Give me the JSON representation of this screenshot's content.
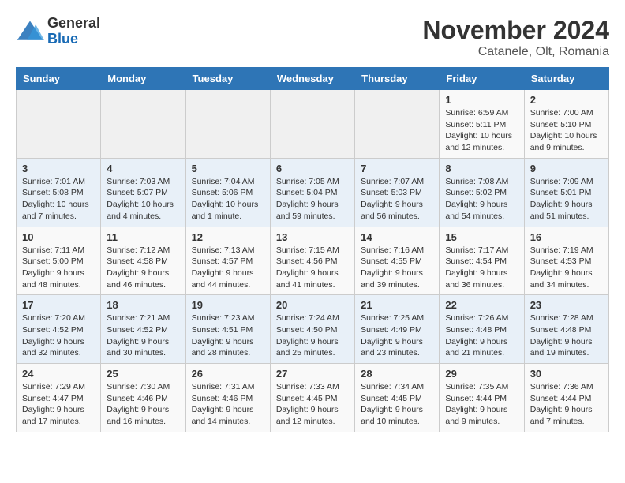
{
  "logo": {
    "general": "General",
    "blue": "Blue"
  },
  "header": {
    "month": "November 2024",
    "location": "Catanele, Olt, Romania"
  },
  "weekdays": [
    "Sunday",
    "Monday",
    "Tuesday",
    "Wednesday",
    "Thursday",
    "Friday",
    "Saturday"
  ],
  "weeks": [
    [
      {
        "day": "",
        "info": ""
      },
      {
        "day": "",
        "info": ""
      },
      {
        "day": "",
        "info": ""
      },
      {
        "day": "",
        "info": ""
      },
      {
        "day": "",
        "info": ""
      },
      {
        "day": "1",
        "info": "Sunrise: 6:59 AM\nSunset: 5:11 PM\nDaylight: 10 hours and 12 minutes."
      },
      {
        "day": "2",
        "info": "Sunrise: 7:00 AM\nSunset: 5:10 PM\nDaylight: 10 hours and 9 minutes."
      }
    ],
    [
      {
        "day": "3",
        "info": "Sunrise: 7:01 AM\nSunset: 5:08 PM\nDaylight: 10 hours and 7 minutes."
      },
      {
        "day": "4",
        "info": "Sunrise: 7:03 AM\nSunset: 5:07 PM\nDaylight: 10 hours and 4 minutes."
      },
      {
        "day": "5",
        "info": "Sunrise: 7:04 AM\nSunset: 5:06 PM\nDaylight: 10 hours and 1 minute."
      },
      {
        "day": "6",
        "info": "Sunrise: 7:05 AM\nSunset: 5:04 PM\nDaylight: 9 hours and 59 minutes."
      },
      {
        "day": "7",
        "info": "Sunrise: 7:07 AM\nSunset: 5:03 PM\nDaylight: 9 hours and 56 minutes."
      },
      {
        "day": "8",
        "info": "Sunrise: 7:08 AM\nSunset: 5:02 PM\nDaylight: 9 hours and 54 minutes."
      },
      {
        "day": "9",
        "info": "Sunrise: 7:09 AM\nSunset: 5:01 PM\nDaylight: 9 hours and 51 minutes."
      }
    ],
    [
      {
        "day": "10",
        "info": "Sunrise: 7:11 AM\nSunset: 5:00 PM\nDaylight: 9 hours and 48 minutes."
      },
      {
        "day": "11",
        "info": "Sunrise: 7:12 AM\nSunset: 4:58 PM\nDaylight: 9 hours and 46 minutes."
      },
      {
        "day": "12",
        "info": "Sunrise: 7:13 AM\nSunset: 4:57 PM\nDaylight: 9 hours and 44 minutes."
      },
      {
        "day": "13",
        "info": "Sunrise: 7:15 AM\nSunset: 4:56 PM\nDaylight: 9 hours and 41 minutes."
      },
      {
        "day": "14",
        "info": "Sunrise: 7:16 AM\nSunset: 4:55 PM\nDaylight: 9 hours and 39 minutes."
      },
      {
        "day": "15",
        "info": "Sunrise: 7:17 AM\nSunset: 4:54 PM\nDaylight: 9 hours and 36 minutes."
      },
      {
        "day": "16",
        "info": "Sunrise: 7:19 AM\nSunset: 4:53 PM\nDaylight: 9 hours and 34 minutes."
      }
    ],
    [
      {
        "day": "17",
        "info": "Sunrise: 7:20 AM\nSunset: 4:52 PM\nDaylight: 9 hours and 32 minutes."
      },
      {
        "day": "18",
        "info": "Sunrise: 7:21 AM\nSunset: 4:52 PM\nDaylight: 9 hours and 30 minutes."
      },
      {
        "day": "19",
        "info": "Sunrise: 7:23 AM\nSunset: 4:51 PM\nDaylight: 9 hours and 28 minutes."
      },
      {
        "day": "20",
        "info": "Sunrise: 7:24 AM\nSunset: 4:50 PM\nDaylight: 9 hours and 25 minutes."
      },
      {
        "day": "21",
        "info": "Sunrise: 7:25 AM\nSunset: 4:49 PM\nDaylight: 9 hours and 23 minutes."
      },
      {
        "day": "22",
        "info": "Sunrise: 7:26 AM\nSunset: 4:48 PM\nDaylight: 9 hours and 21 minutes."
      },
      {
        "day": "23",
        "info": "Sunrise: 7:28 AM\nSunset: 4:48 PM\nDaylight: 9 hours and 19 minutes."
      }
    ],
    [
      {
        "day": "24",
        "info": "Sunrise: 7:29 AM\nSunset: 4:47 PM\nDaylight: 9 hours and 17 minutes."
      },
      {
        "day": "25",
        "info": "Sunrise: 7:30 AM\nSunset: 4:46 PM\nDaylight: 9 hours and 16 minutes."
      },
      {
        "day": "26",
        "info": "Sunrise: 7:31 AM\nSunset: 4:46 PM\nDaylight: 9 hours and 14 minutes."
      },
      {
        "day": "27",
        "info": "Sunrise: 7:33 AM\nSunset: 4:45 PM\nDaylight: 9 hours and 12 minutes."
      },
      {
        "day": "28",
        "info": "Sunrise: 7:34 AM\nSunset: 4:45 PM\nDaylight: 9 hours and 10 minutes."
      },
      {
        "day": "29",
        "info": "Sunrise: 7:35 AM\nSunset: 4:44 PM\nDaylight: 9 hours and 9 minutes."
      },
      {
        "day": "30",
        "info": "Sunrise: 7:36 AM\nSunset: 4:44 PM\nDaylight: 9 hours and 7 minutes."
      }
    ]
  ]
}
